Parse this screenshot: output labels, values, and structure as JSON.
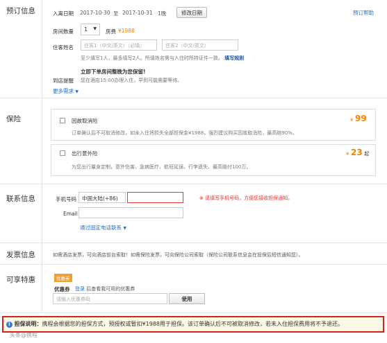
{
  "booking": {
    "section_label": "预订信息",
    "help_link": "预订帮助",
    "checkin_label": "入离日期",
    "checkin_date": "2017-10-30",
    "date_separator": "至",
    "checkout_date": "2017-10-31",
    "nights": "1晚",
    "modify_dates_button": "修改日期",
    "rooms_label": "房间数量",
    "rooms_value": "1",
    "room_fee_label": "房费",
    "room_fee_value": "¥1988",
    "guest_name_label": "住客姓名",
    "guest1_placeholder": "住客1（中文/英文）（必填）",
    "guest2_placeholder": "住客2（中文/英文）",
    "guest_hint": "至少填写1人，最多填写2人。所填姓名需与入住时所持证件一致。",
    "fill_guide_link": "填写规则",
    "arrival_label": "到店提醒",
    "arrival_title": "立即下单房间整晚为您保留!",
    "arrival_desc": "您在酒店15:00办理入住，早到可能需要等待。",
    "more_link": "更多需求"
  },
  "insurance": {
    "section_label": "保险",
    "cancel_title": "因故取消险",
    "cancel_desc": "订单确认后不可取消修改，如未入住将损失全部担保金¥1988，强烈建议购买因故取消险，最高赔90%。",
    "cancel_price_symbol": "¥",
    "cancel_price": "99",
    "travel_title": "出行意外险",
    "travel_desc": "为您出行量身定制，意外伤害、急病医疗、航班延误、行李遗失、最高赔付100万。",
    "travel_price_symbol": "¥",
    "travel_price": "23",
    "travel_price_suffix": "起"
  },
  "contact": {
    "section_label": "联系信息",
    "phone_label": "手机号码",
    "country_code": "中国大陆(+86)",
    "phone_error": "请填写手机号码，方便您接收担保通知。",
    "email_label": "Email",
    "landline_link": "通过固定电话联系"
  },
  "invoice": {
    "section_label": "发票信息",
    "text": "如需酒店发票，可向酒店前台索取！如需保险发票，可向保险公司索取（保险公司联系信息会在投保后短信通知您）。"
  },
  "benefits": {
    "section_label": "可享特惠",
    "badge": "优惠券",
    "coupon_label": "优惠券",
    "login_link": "登录",
    "login_suffix": "后查看我可用的优惠券",
    "coupon_placeholder": "请输入优惠券码",
    "use_button": "使用"
  },
  "notice": {
    "title": "担保说明：",
    "text": "携程会根据您的担保方式，预授权或暂扣¥1988用于担保。该订单确认后不可被取消修改，若未入住担保费用将不予退还。"
  },
  "watermark": "头条@携程"
}
